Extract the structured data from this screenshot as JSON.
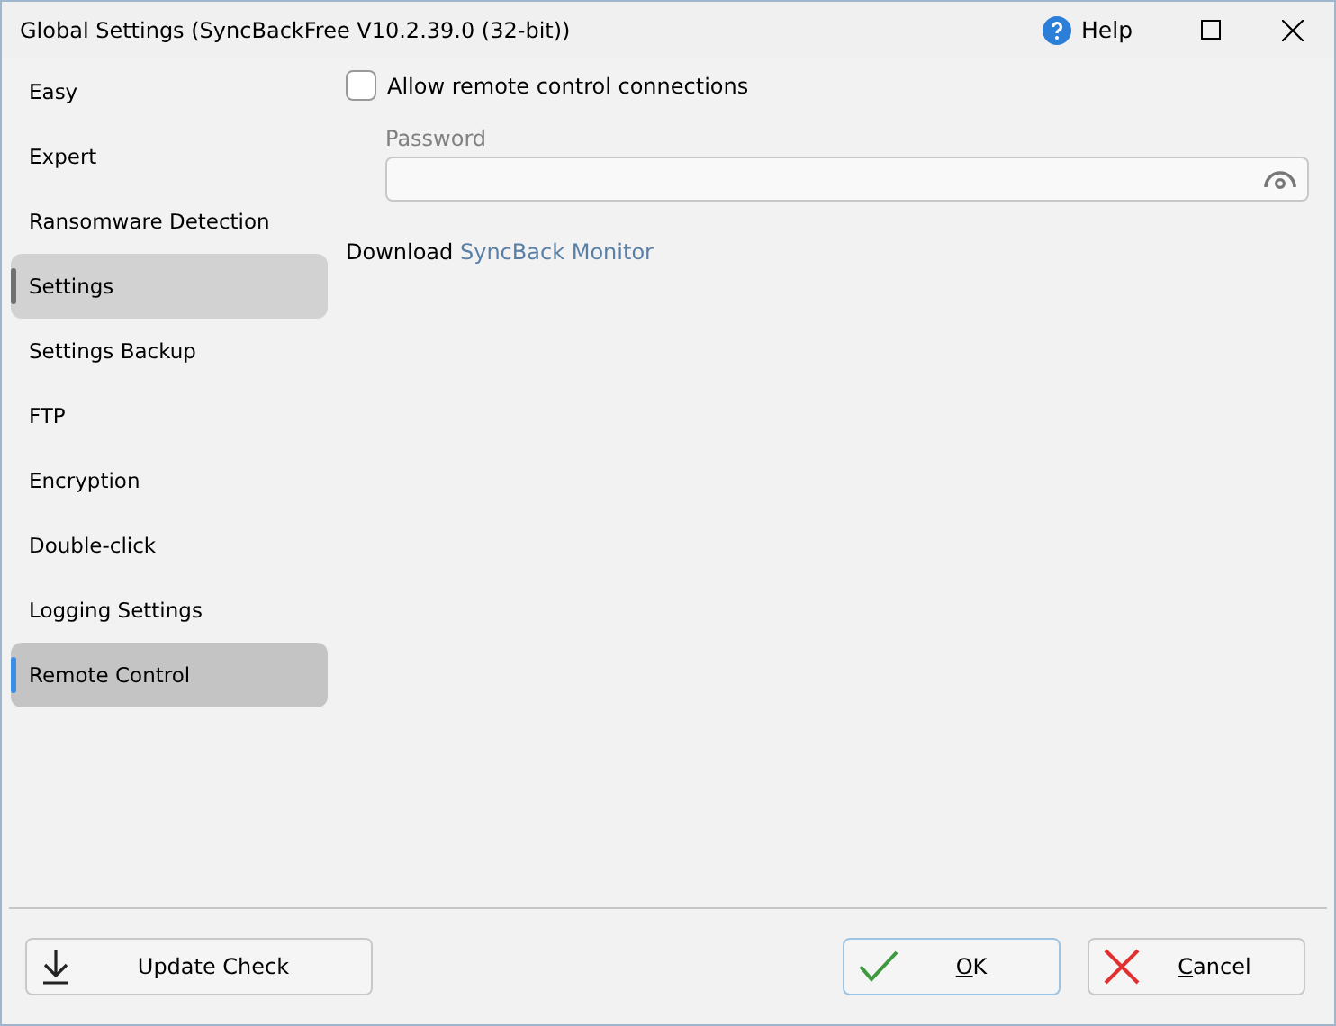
{
  "window": {
    "title": "Global Settings (SyncBackFree V10.2.39.0 (32-bit))",
    "help": "Help"
  },
  "sidebar": {
    "items": [
      {
        "label": "Easy",
        "selected": false,
        "hovered": false
      },
      {
        "label": "Expert",
        "selected": false,
        "hovered": false
      },
      {
        "label": "Ransomware Detection",
        "selected": false,
        "hovered": false
      },
      {
        "label": "Settings",
        "selected": false,
        "hovered": true
      },
      {
        "label": "Settings Backup",
        "selected": false,
        "hovered": false
      },
      {
        "label": "FTP",
        "selected": false,
        "hovered": false
      },
      {
        "label": "Encryption",
        "selected": false,
        "hovered": false
      },
      {
        "label": "Double-click",
        "selected": false,
        "hovered": false
      },
      {
        "label": "Logging Settings",
        "selected": false,
        "hovered": false
      },
      {
        "label": "Remote Control",
        "selected": true,
        "hovered": false
      }
    ]
  },
  "content": {
    "allow_remote": {
      "label": "Allow remote control connections",
      "checked": false
    },
    "password": {
      "label": "Password"
    },
    "download": {
      "text": "Download",
      "link": "SyncBack Monitor"
    }
  },
  "buttons": [
    {
      "kind": "update",
      "rest": "Update Check"
    },
    {
      "kind": "ok",
      "key": "O",
      "rest": "K"
    },
    {
      "kind": "cancel",
      "key": "C",
      "rest": "ancel"
    }
  ]
}
